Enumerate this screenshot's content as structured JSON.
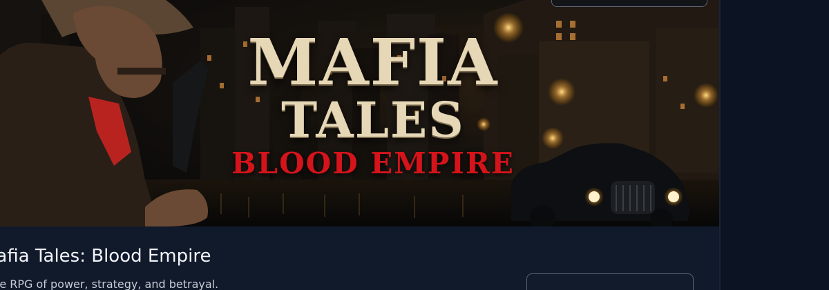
{
  "banner": {
    "title_line1": "MAFIA",
    "title_line2": "TALES",
    "title_line3": "BLOOD EMPIRE"
  },
  "game": {
    "title": "Mafia Tales: Blood Empire",
    "description": "Idle RPG of power, strategy, and betrayal."
  },
  "colors": {
    "page_bg": "#0b1220",
    "card_bg": "#111a2b",
    "title_cream": "#e6d7b6",
    "title_red": "#d4141a",
    "border": "#5a6272"
  }
}
